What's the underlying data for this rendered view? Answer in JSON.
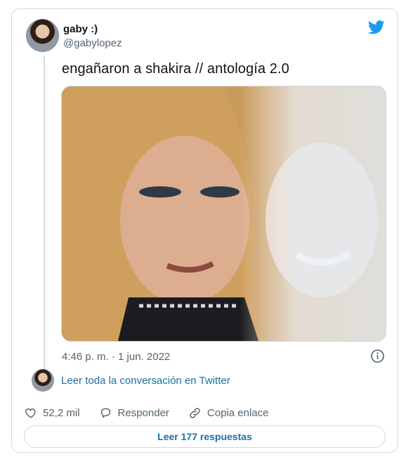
{
  "user": {
    "display_name": "gaby :)",
    "handle": "@gabylopez"
  },
  "tweet": {
    "text": "engañaron a shakira // antología 2.0",
    "timestamp": "4:46 p. m. · 1 jun. 2022"
  },
  "media": {
    "description_icon": "photo-image"
  },
  "thread": {
    "read_conversation": "Leer toda la conversación en Twitter"
  },
  "actions": {
    "likes": "52,2 mil",
    "reply_label": "Responder",
    "copy_link_label": "Copia enlace"
  },
  "replies_button": "Leer 177 respuestas",
  "colors": {
    "accent": "#1d9bf0",
    "link": "#1d6fa5",
    "muted": "#536471",
    "border": "#cfd9de"
  },
  "icons": [
    "twitter-bird-icon",
    "info-icon",
    "heart-icon",
    "reply-bubble-icon",
    "link-icon"
  ]
}
